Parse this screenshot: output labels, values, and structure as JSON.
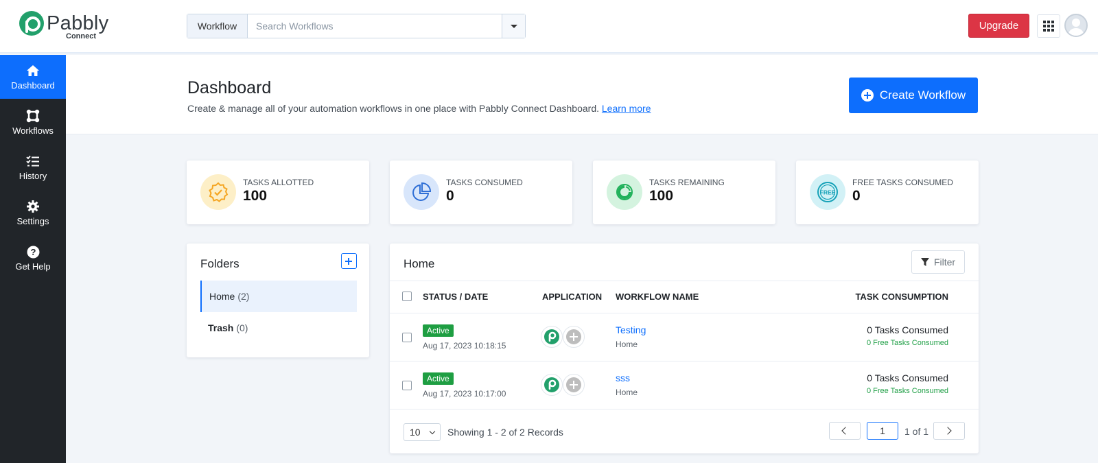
{
  "brand": {
    "name": "Pabbly",
    "product": "Connect",
    "color": "#22a06b"
  },
  "topbar": {
    "search_type": "Workflow",
    "search_placeholder": "Search Workflows",
    "upgrade_label": "Upgrade",
    "upgrade_color": "#dc3545"
  },
  "sidebar": {
    "items": [
      {
        "label": "Dashboard",
        "icon": "home-icon",
        "active": true
      },
      {
        "label": "Workflows",
        "icon": "workflows-icon",
        "active": false
      },
      {
        "label": "History",
        "icon": "history-list-icon",
        "active": false
      },
      {
        "label": "Settings",
        "icon": "gear-icon",
        "active": false
      },
      {
        "label": "Get Help",
        "icon": "help-circle-icon",
        "active": false
      }
    ]
  },
  "header": {
    "title": "Dashboard",
    "subtitle": "Create & manage all of your automation workflows in one place with Pabbly Connect Dashboard.",
    "learn_more": "Learn more",
    "create_label": "Create Workflow",
    "accent": "#0d6efd"
  },
  "stats": [
    {
      "label": "Tasks Allotted",
      "value": "100",
      "icon": "badge-check-icon",
      "color": "#f5a623"
    },
    {
      "label": "Tasks Consumed",
      "value": "0",
      "icon": "pie-chart-icon",
      "color": "#2f6fd6"
    },
    {
      "label": "Tasks Remaining",
      "value": "100",
      "icon": "ring-chart-icon",
      "color": "#20b15a"
    },
    {
      "label": "Free Tasks Consumed",
      "value": "0",
      "icon": "free-badge-icon",
      "color": "#17a2b8"
    }
  ],
  "folders": {
    "title": "Folders",
    "items": [
      {
        "name": "Home",
        "count": "(2)",
        "selected": true
      },
      {
        "name": "Trash",
        "count": "(0)",
        "selected": false
      }
    ]
  },
  "table": {
    "title": "Home",
    "filter_label": "Filter",
    "columns": [
      "STATUS / DATE",
      "APPLICATION",
      "WORKFLOW NAME",
      "TASK CONSUMPTION"
    ],
    "rows": [
      {
        "status": "Active",
        "date": "Aug 17, 2023 10:18:15",
        "name": "Testing",
        "folder": "Home",
        "tasks": "0 Tasks Consumed",
        "free": "0 Free Tasks Consumed"
      },
      {
        "status": "Active",
        "date": "Aug 17, 2023 10:17:00",
        "name": "sss",
        "folder": "Home",
        "tasks": "0 Tasks Consumed",
        "free": "0 Free Tasks Consumed"
      }
    ],
    "page_size": "10",
    "showing": "Showing 1 - 2 of 2 Records",
    "page": "1",
    "page_of": "1 of 1"
  }
}
